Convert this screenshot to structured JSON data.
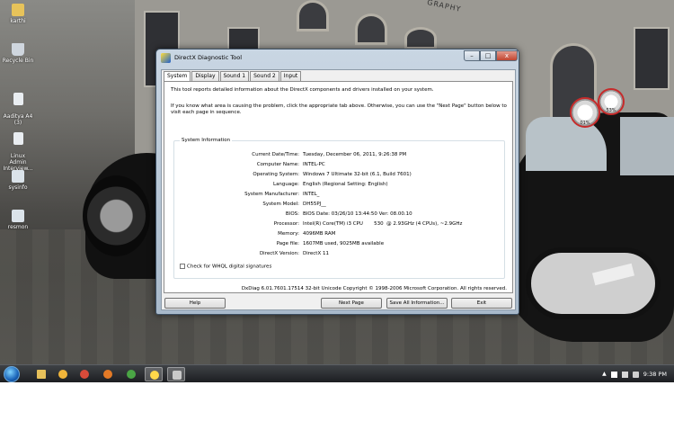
{
  "desktop": {
    "icons": [
      {
        "label": "karthi",
        "icon": "folder-icon",
        "color": "#e7c35a"
      },
      {
        "label": "Recycle Bin",
        "icon": "recycle-bin-icon",
        "color": "#cfd6de"
      },
      {
        "label": "Aaditya A4\n(3)",
        "icon": "document-icon",
        "color": "#e9edf1"
      },
      {
        "label": "Linux Admin\nInterview...",
        "icon": "document-icon",
        "color": "#e9edf1"
      },
      {
        "label": "sysinfo",
        "icon": "shortcut-icon",
        "color": "#dbe3ea"
      },
      {
        "label": "resmon",
        "icon": "shortcut-icon",
        "color": "#dbe3ea"
      }
    ],
    "wall_text": "GRAPHY",
    "gadget_values": [
      "01%",
      "53%"
    ]
  },
  "window": {
    "title": "DirectX Diagnostic Tool",
    "tabs": [
      "System",
      "Display",
      "Sound 1",
      "Sound 2",
      "Input"
    ],
    "active_tab": "System",
    "intro1": "This tool reports detailed information about the DirectX components and drivers installed on your system.",
    "intro2": "If you know what area is causing the problem, click the appropriate tab above.  Otherwise, you can use the \"Next Page\" button below to visit each page in sequence.",
    "group_title": "System Information",
    "info_rows": [
      {
        "k": "Current Date/Time:",
        "v": "Tuesday, December 06, 2011, 9:26:38 PM"
      },
      {
        "k": "Computer Name:",
        "v": "INTEL-PC"
      },
      {
        "k": "Operating System:",
        "v": "Windows 7 Ultimate 32-bit (6.1, Build 7601)"
      },
      {
        "k": "Language:",
        "v": "English (Regional Setting: English)"
      },
      {
        "k": "System Manufacturer:",
        "v": "INTEL_"
      },
      {
        "k": "System Model:",
        "v": "DH55PJ__"
      },
      {
        "k": "BIOS:",
        "v": "BIOS Date: 03/26/10 13:44:50 Ver: 08.00.10"
      },
      {
        "k": "Processor:",
        "v": "Intel(R) Core(TM) i3 CPU       530  @ 2.93GHz (4 CPUs), ~2.9GHz"
      },
      {
        "k": "Memory:",
        "v": "4096MB RAM"
      },
      {
        "k": "Page file:",
        "v": "1607MB used, 9025MB available"
      },
      {
        "k": "DirectX Version:",
        "v": "DirectX 11"
      }
    ],
    "whql_label": "Check for WHQL digital signatures",
    "footer_info": "DxDiag 6.01.7601.17514 32-bit Unicode  Copyright © 1998-2006 Microsoft Corporation.  All rights reserved.",
    "buttons": {
      "help": "Help",
      "next": "Next Page",
      "save": "Save All Information...",
      "exit": "Exit"
    },
    "caption": {
      "min": "–",
      "max": "□",
      "close": "x"
    }
  },
  "taskbar": {
    "apps": [
      {
        "name": "explorer",
        "color": "#e6c05a"
      },
      {
        "name": "chrome-like",
        "color": "#f0b53a"
      },
      {
        "name": "flower",
        "color": "#d94b3a"
      },
      {
        "name": "firefox",
        "color": "#e47a26"
      },
      {
        "name": "chrome",
        "color": "#4aa545"
      },
      {
        "name": "dxdiag",
        "color": "#ffd84a"
      },
      {
        "name": "tool",
        "color": "#c9c9c9"
      }
    ],
    "clock": "9:38 PM"
  }
}
